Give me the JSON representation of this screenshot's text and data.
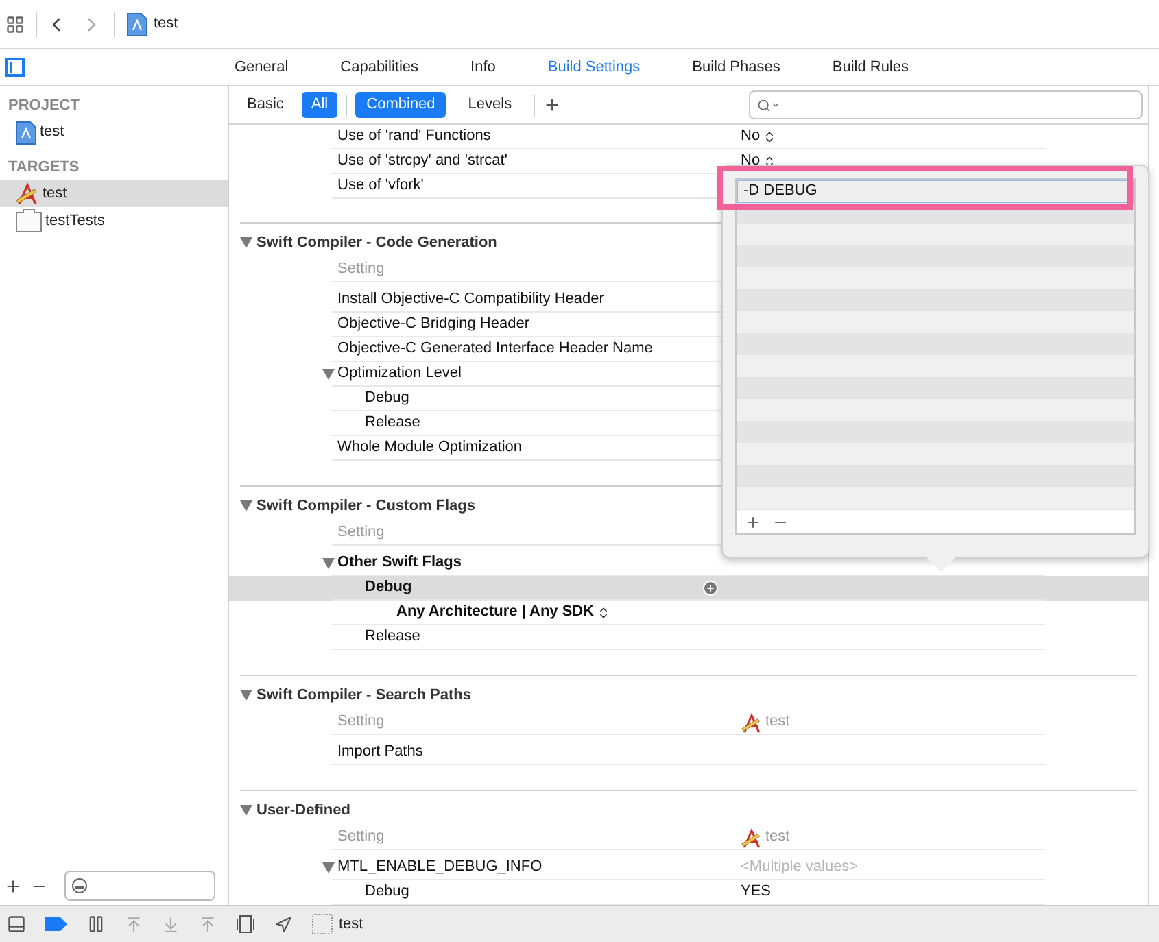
{
  "toolbar": {
    "file_name": "test",
    "forward_enabled": false
  },
  "tabs": [
    {
      "label": "General",
      "selected": false
    },
    {
      "label": "Capabilities",
      "selected": false
    },
    {
      "label": "Info",
      "selected": false
    },
    {
      "label": "Build Settings",
      "selected": true
    },
    {
      "label": "Build Phases",
      "selected": false
    },
    {
      "label": "Build Rules",
      "selected": false
    }
  ],
  "filter_bar": {
    "scope": [
      {
        "label": "Basic",
        "selected": false
      },
      {
        "label": "All",
        "selected": true
      }
    ],
    "view": [
      {
        "label": "Combined",
        "selected": true
      },
      {
        "label": "Levels",
        "selected": false
      }
    ]
  },
  "sidebar": {
    "groups": [
      {
        "title": "PROJECT",
        "items": [
          {
            "label": "test",
            "kind": "project",
            "selected": false
          }
        ]
      },
      {
        "title": "TARGETS",
        "items": [
          {
            "label": "test",
            "kind": "app",
            "selected": true
          },
          {
            "label": "testTests",
            "kind": "bundle",
            "selected": false
          }
        ]
      }
    ]
  },
  "sections": [
    {
      "rows": [
        {
          "label": "Use of 'rand' Functions",
          "value": "No",
          "popup": true
        },
        {
          "label": "Use of 'strcpy' and 'strcat'",
          "value": "No",
          "popup": true
        },
        {
          "label": "Use of 'vfork'"
        }
      ]
    },
    {
      "title": "Swift Compiler - Code Generation",
      "column": "Setting",
      "rows": [
        {
          "label": "Install Objective-C Compatibility Header"
        },
        {
          "label": "Objective-C Bridging Header"
        },
        {
          "label": "Objective-C Generated Interface Header Name"
        },
        {
          "label": "Optimization Level",
          "expanded": true,
          "children": [
            {
              "label": "Debug"
            },
            {
              "label": "Release"
            }
          ]
        },
        {
          "label": "Whole Module Optimization"
        }
      ]
    },
    {
      "title": "Swift Compiler - Custom Flags",
      "column": "Setting",
      "rows": [
        {
          "label": "Other Swift Flags",
          "expanded": true,
          "modified": true,
          "children": [
            {
              "label": "Debug",
              "modified": true,
              "selected": true,
              "children": [
                {
                  "label": "Any Architecture | Any SDK",
                  "modified": true,
                  "popup": true
                }
              ]
            },
            {
              "label": "Release"
            }
          ]
        }
      ]
    },
    {
      "title": "Swift Compiler - Search Paths",
      "column": "Setting",
      "target": "test",
      "rows": [
        {
          "label": "Import Paths"
        }
      ]
    },
    {
      "title": "User-Defined",
      "column": "Setting",
      "target": "test",
      "rows": [
        {
          "label": "MTL_ENABLE_DEBUG_INFO",
          "expanded": true,
          "value": "<Multiple values>",
          "value_dim": true,
          "children": [
            {
              "label": "Debug",
              "value": "YES"
            }
          ]
        }
      ]
    }
  ],
  "popover": {
    "values": [
      "-D DEBUG"
    ],
    "editing": true
  },
  "debug_bar": {
    "breakpoints_active": true,
    "scheme": "test"
  }
}
